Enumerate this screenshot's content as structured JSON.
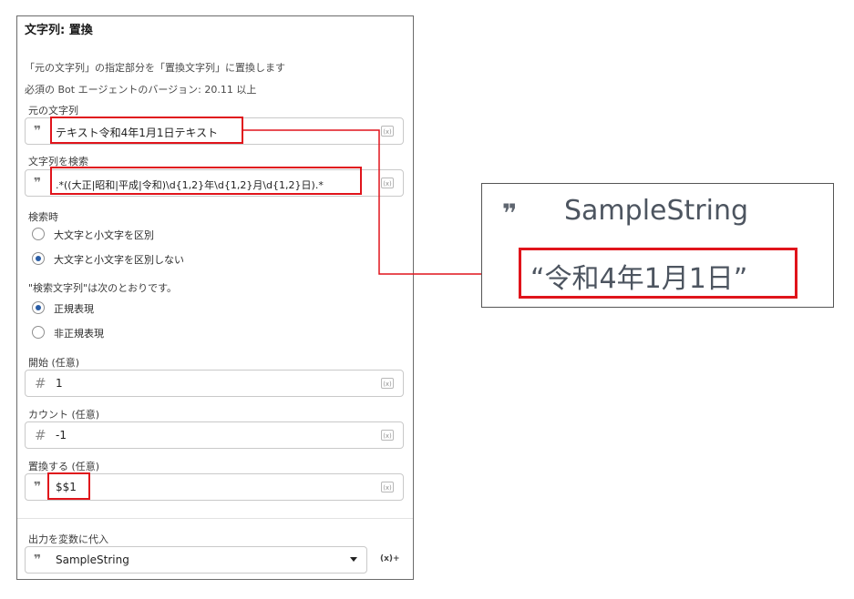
{
  "panel": {
    "title": "文字列: 置換",
    "description": "「元の文字列」の指定部分を「置換文字列」に置換します",
    "bot_version": "必須の Bot エージェントのバージョン: 20.11 以上",
    "source_label": "元の文字列",
    "source_value": "テキスト令和4年1月1日テキスト",
    "search_label": "文字列を検索",
    "search_value": ".*((大正|昭和|平成|令和)\\d{1,2}年\\d{1,2}月\\d{1,2}日).*",
    "case_label": "検索時",
    "case_options": [
      "大文字と小文字を区別",
      "大文字と小文字を区別しない"
    ],
    "case_selected": 1,
    "regex_label": "\"検索文字列\"は次のとおりです。",
    "regex_options": [
      "正規表現",
      "非正規表現"
    ],
    "regex_selected": 0,
    "start_label": "開始 (任意)",
    "start_value": "1",
    "count_label": "カウント (任意)",
    "count_value": "-1",
    "replace_label": "置換する (任意)",
    "replace_value": "$$1",
    "output_label": "出力を変数に代入",
    "output_value": "SampleString",
    "var_icon_text": "(x)",
    "add_var_text": "(x)+",
    "quote_glyph": "❞"
  },
  "zoom": {
    "variable_name": "SampleString",
    "result_value": "“令和4年1月1日”"
  },
  "colors": {
    "highlight": "#e0141b",
    "radio_selected": "#2a5da6"
  },
  "icons": [
    "quote-icon",
    "hash-icon",
    "variable-icon",
    "chevron-down-icon",
    "add-variable-icon"
  ]
}
